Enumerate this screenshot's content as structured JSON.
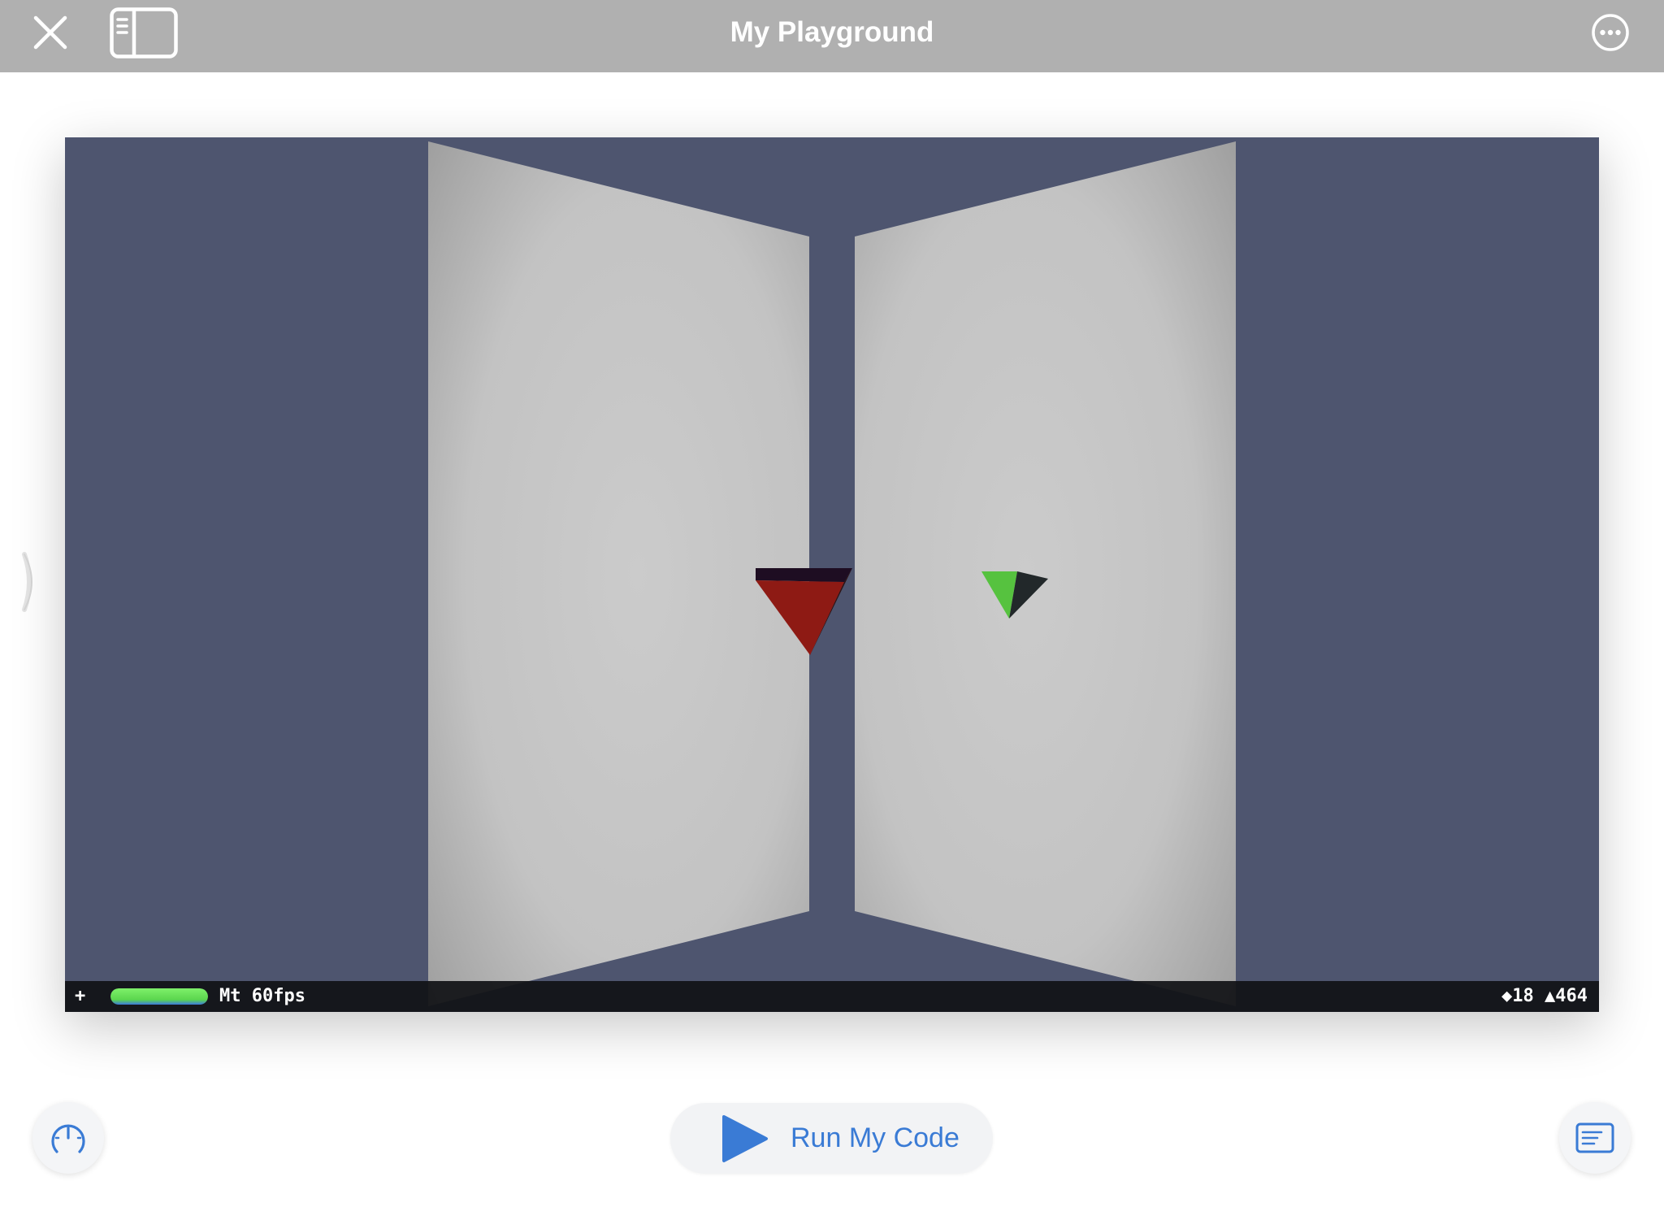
{
  "app": {
    "title": "My Playground"
  },
  "header": {
    "close_icon": "close-icon",
    "sidebar_icon": "sidebar-toggle-icon",
    "more_icon": "ellipsis-circle-icon"
  },
  "live_view": {
    "background_color": "#4e556f",
    "scene": {
      "panel_color": "#c9c9c9",
      "red_object_color": "#8e1a14",
      "green_object_color": "#56c23f"
    },
    "stats": {
      "plus_label": "+",
      "fps_label": "Mt 60fps",
      "meter_level_percent": 100,
      "meter_color": "#5bd64e",
      "counts_label": "◆18 ▲464"
    }
  },
  "footer": {
    "run_button_label": "Run My Code",
    "run_icon": "play-icon",
    "speed_icon": "speedometer-icon",
    "glossary_icon": "glossary-text-icon",
    "accent_color": "#3a7bd5"
  },
  "side_handle_icon": "chevron-right-icon"
}
